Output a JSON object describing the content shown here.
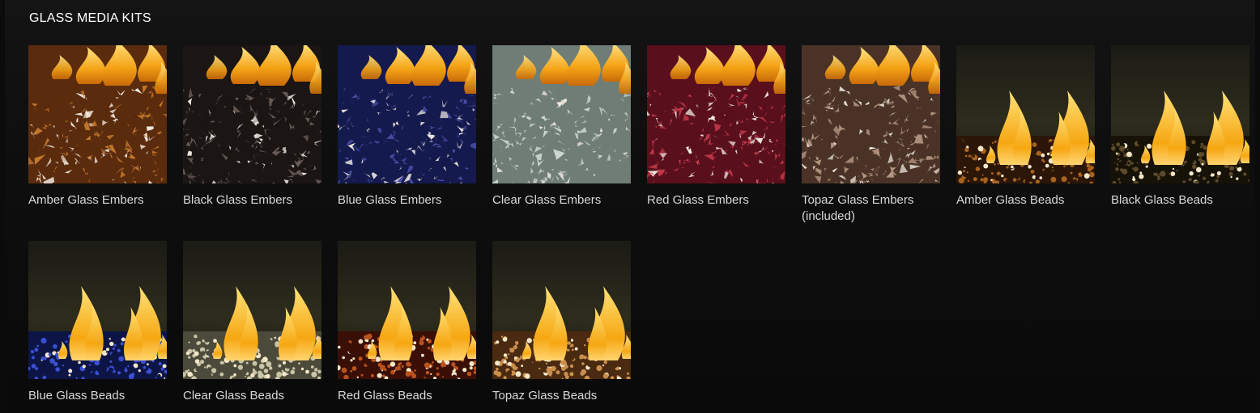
{
  "section_title": "GLASS MEDIA KITS",
  "row1": [
    {
      "label": "Amber Glass Embers",
      "kind": "embers",
      "color": "#c77a2e",
      "dark": "#5a2b0c"
    },
    {
      "label": "Black Glass Embers",
      "kind": "embers",
      "color": "#6a5d58",
      "dark": "#1b1514"
    },
    {
      "label": "Blue Glass Embers",
      "kind": "embers",
      "color": "#4a4fa8",
      "dark": "#141a4d"
    },
    {
      "label": "Clear Glass Embers",
      "kind": "embers",
      "color": "#cfd8d2",
      "dark": "#6f7d76"
    },
    {
      "label": "Red Glass Embers",
      "kind": "embers",
      "color": "#c2384a",
      "dark": "#5a0f1c"
    },
    {
      "label": "Topaz Glass Embers (included)",
      "kind": "embers",
      "color": "#b89a86",
      "dark": "#4a3326"
    },
    {
      "label": "Amber Glass Beads",
      "kind": "beads",
      "color": "#a8631e",
      "dark": "#2b1608"
    },
    {
      "label": "Black Glass Beads",
      "kind": "beads",
      "color": "#5c4a2a",
      "dark": "#171208"
    }
  ],
  "row2": [
    {
      "label": "Blue Glass Beads",
      "kind": "beads",
      "color": "#3b4fd1",
      "dark": "#0d1547"
    },
    {
      "label": "Clear Glass Beads",
      "kind": "beads",
      "color": "#c9c4a6",
      "dark": "#4c4a3a"
    },
    {
      "label": "Red Glass Beads",
      "kind": "beads",
      "color": "#b8521e",
      "dark": "#3a0f06"
    },
    {
      "label": "Topaz Glass Beads",
      "kind": "beads",
      "color": "#c98e4c",
      "dark": "#4a2a10"
    }
  ]
}
